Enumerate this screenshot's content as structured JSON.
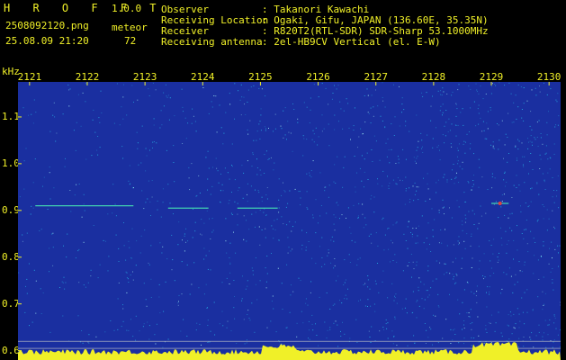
{
  "header": {
    "app_name": "H R O F F T",
    "version": "1.0.0",
    "filename": "2508092120.png",
    "mode": "meteor",
    "datetime": "25.08.09 21:20",
    "count": "72",
    "fields": [
      {
        "label": "Observer",
        "value": ": Takanori Kawachi"
      },
      {
        "label": "Receiving Location",
        "value": ": Ogaki, Gifu, JAPAN (136.60E, 35.35N)"
      },
      {
        "label": "Receiver",
        "value": ": R820T2(RTL-SDR) SDR-Sharp 53.1000MHz"
      },
      {
        "label": "Receiving antenna",
        "value": ": 2el-HB9CV Vertical (el. E-W)"
      }
    ]
  },
  "chart_data": {
    "type": "heatmap",
    "ylabel": "kHz",
    "x_ticks": [
      "2121",
      "2122",
      "2123",
      "2124",
      "2125",
      "2126",
      "2127",
      "2128",
      "2129",
      "2130"
    ],
    "y_ticks": [
      "1.1",
      "1.0",
      "0.9",
      "0.8",
      "0.7",
      "0.6"
    ],
    "ylim": [
      0.58,
      1.175
    ],
    "xlim": [
      2120.8,
      2130.2
    ],
    "background_color": "#1a2fa0",
    "noise_color": "#24a8e0",
    "signal_color": "#40d0b0",
    "strong_signal_color": "#e04040",
    "meteor_traces": [
      {
        "x_start": 2121.1,
        "x_end": 2122.8,
        "y": 0.91
      },
      {
        "x_start": 2123.4,
        "x_end": 2124.1,
        "y": 0.905
      },
      {
        "x_start": 2124.6,
        "x_end": 2125.3,
        "y": 0.905
      },
      {
        "x_start": 2129.0,
        "x_end": 2129.3,
        "y": 0.915
      }
    ],
    "reference_lines_y": [
      0.62,
      0.605
    ]
  }
}
